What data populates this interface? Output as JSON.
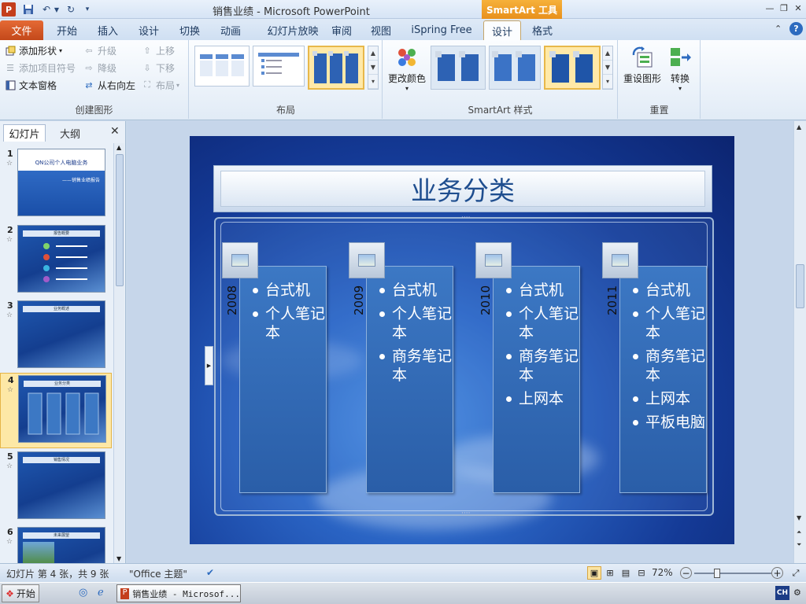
{
  "window": {
    "title": "销售业绩 - Microsoft PowerPoint",
    "context_tab": "SmartArt 工具",
    "app_icon": "P"
  },
  "tabs": [
    "文件",
    "开始",
    "插入",
    "设计",
    "切换",
    "动画",
    "幻灯片放映",
    "审阅",
    "视图",
    "iSpring Free",
    "设计",
    "格式"
  ],
  "ribbon": {
    "create": {
      "add_shape": "添加形状",
      "add_bullet": "添加项目符号",
      "text_pane": "文本窗格",
      "promote": "升级",
      "demote": "降级",
      "rtl": "从右向左",
      "move_up": "上移",
      "move_down": "下移",
      "layout": "布局",
      "label": "创建图形"
    },
    "layout_label": "布局",
    "change_colors": "更改颜色",
    "styles_label": "SmartArt 样式",
    "reset": {
      "reset_graphic": "重设图形",
      "convert": "转换",
      "label": "重置"
    }
  },
  "left_panel": {
    "tab_slides": "幻灯片",
    "tab_outline": "大纲",
    "slides": [
      {
        "num": "1",
        "title": "QN公司个人电脑业务",
        "subtitle": "——销售业绩报告"
      },
      {
        "num": "2",
        "title": "报告概要"
      },
      {
        "num": "3",
        "title": "业务概述"
      },
      {
        "num": "4",
        "title": "业务分类"
      },
      {
        "num": "5",
        "title": "销售情况"
      },
      {
        "num": "6",
        "title": "未来展望"
      }
    ]
  },
  "slide": {
    "title": "业务分类",
    "columns": [
      {
        "year": "2008",
        "items": [
          "台式机",
          "个人笔记本"
        ]
      },
      {
        "year": "2009",
        "items": [
          "台式机",
          "个人笔记本",
          "商务笔记本"
        ]
      },
      {
        "year": "2010",
        "items": [
          "台式机",
          "个人笔记本",
          "商务笔记本",
          "上网本"
        ]
      },
      {
        "year": "2011",
        "items": [
          "台式机",
          "个人笔记本",
          "商务笔记本",
          "上网本",
          "平板电脑"
        ]
      }
    ]
  },
  "status": {
    "slide_info": "幻灯片 第 4 张，共 9 张",
    "theme": "\"Office 主题\"",
    "zoom": "72%",
    "zoom_fraction": 0.3
  },
  "taskbar": {
    "start": "开始",
    "task": "销售业绩 - Microsof...",
    "ime": "CH"
  }
}
